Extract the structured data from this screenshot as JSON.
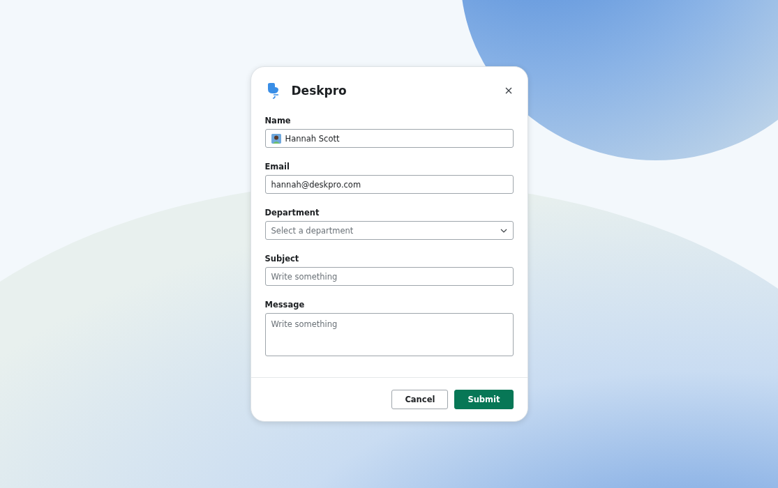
{
  "dialog": {
    "title": "Deskpro",
    "fields": [
      {
        "kind": "text",
        "label": "Name",
        "value": "Hannah Scott",
        "avatar": true
      },
      {
        "kind": "text",
        "label": "Email",
        "value": "hannah@deskpro.com"
      },
      {
        "kind": "select",
        "label": "Department",
        "placeholder": "Select a department"
      },
      {
        "kind": "text",
        "label": "Subject",
        "placeholder": "Write something"
      },
      {
        "kind": "textarea",
        "label": "Message",
        "placeholder": "Write something"
      }
    ],
    "buttons": [
      {
        "label": "Cancel",
        "kind": "secondary"
      },
      {
        "label": "Submit",
        "kind": "primary"
      }
    ]
  }
}
